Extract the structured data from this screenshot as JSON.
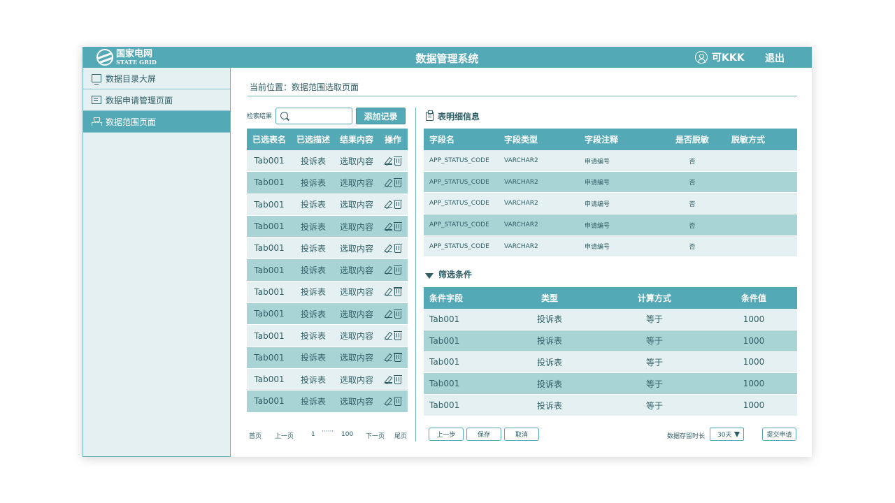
{
  "header": {
    "logo_cn": "国家电网",
    "logo_en": "STATE GRID",
    "title": "数据管理系统",
    "user": "可KKK",
    "logout": "退出"
  },
  "sidebar": {
    "items": [
      {
        "label": "数据目录大屏",
        "icon": "monitor-icon"
      },
      {
        "label": "数据申请管理页面",
        "icon": "document-icon"
      },
      {
        "label": "数据范围页面",
        "icon": "hierarchy-icon",
        "active": true
      }
    ]
  },
  "breadcrumb": "当前位置：数据范围选取页面",
  "search": {
    "label": "检索结果",
    "value": "",
    "add_button": "添加记录"
  },
  "left_table": {
    "headers": [
      "已选表名",
      "已选描述",
      "结果内容",
      "操作"
    ],
    "rows": [
      [
        "Tab001",
        "投诉表",
        "选取内容"
      ],
      [
        "Tab001",
        "投诉表",
        "选取内容"
      ],
      [
        "Tab001",
        "投诉表",
        "选取内容"
      ],
      [
        "Tab001",
        "投诉表",
        "选取内容"
      ],
      [
        "Tab001",
        "投诉表",
        "选取内容"
      ],
      [
        "Tab001",
        "投诉表",
        "选取内容"
      ],
      [
        "Tab001",
        "投诉表",
        "选取内容"
      ],
      [
        "Tab001",
        "投诉表",
        "选取内容"
      ],
      [
        "Tab001",
        "投诉表",
        "选取内容"
      ],
      [
        "Tab001",
        "投诉表",
        "选取内容"
      ],
      [
        "Tab001",
        "投诉表",
        "选取内容"
      ],
      [
        "Tab001",
        "投诉表",
        "选取内容"
      ]
    ]
  },
  "pager": {
    "first": "首页",
    "prev": "上一页",
    "page_start": "1",
    "ellipsis": "······",
    "page_end": "100",
    "next": "下一页",
    "last": "尾页"
  },
  "detail": {
    "title": "表明细信息",
    "headers": [
      "字段名",
      "字段类型",
      "字段注释",
      "是否脱敏",
      "脱敏方式"
    ],
    "rows": [
      [
        "APP_STATUS_CODE",
        "VARCHAR2",
        "申请编号",
        "否",
        ""
      ],
      [
        "APP_STATUS_CODE",
        "VARCHAR2",
        "申请编号",
        "否",
        ""
      ],
      [
        "APP_STATUS_CODE",
        "VARCHAR2",
        "申请编号",
        "否",
        ""
      ],
      [
        "APP_STATUS_CODE",
        "VARCHAR2",
        "申请编号",
        "否",
        ""
      ],
      [
        "APP_STATUS_CODE",
        "VARCHAR2",
        "申请编号",
        "否",
        ""
      ]
    ]
  },
  "filters": {
    "title": "筛选条件",
    "headers": [
      "条件字段",
      "类型",
      "计算方式",
      "条件值"
    ],
    "rows": [
      [
        "Tab001",
        "投诉表",
        "等于",
        "1000"
      ],
      [
        "Tab001",
        "投诉表",
        "等于",
        "1000"
      ],
      [
        "Tab001",
        "投诉表",
        "等于",
        "1000"
      ],
      [
        "Tab001",
        "投诉表",
        "等于",
        "1000"
      ],
      [
        "Tab001",
        "投诉表",
        "等于",
        "1000"
      ]
    ]
  },
  "footer": {
    "prev_step": "上一步",
    "save": "保存",
    "cancel": "取消",
    "storage_label": "数据存留时长",
    "storage_value": "30天",
    "submit": "提交申请"
  },
  "colors": {
    "accent": "#53a9b6",
    "row_light": "#e4f0f1",
    "row_dark": "#a9d4d6",
    "text": "#2f5f66"
  }
}
